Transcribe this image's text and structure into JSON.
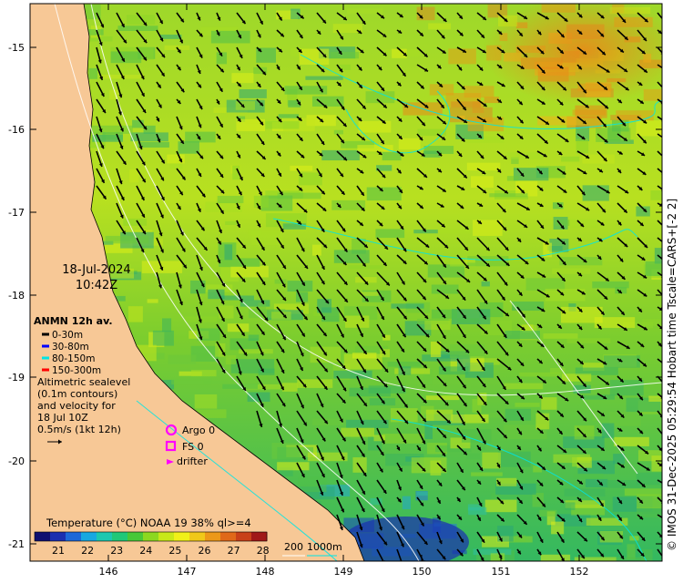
{
  "map": {
    "lon_ticks": [
      "146",
      "147",
      "148",
      "149",
      "150",
      "151",
      "152"
    ],
    "lat_ticks": [
      "15",
      "16",
      "17",
      "18",
      "19",
      "20",
      "21"
    ],
    "lat_prefix": "-"
  },
  "overlay": {
    "date": "18-Jul-2024",
    "time": "10:42Z",
    "anmn_title": "ANMN 12h av.",
    "anmn_items": [
      {
        "label": "0-30m",
        "color": "#000000"
      },
      {
        "label": "30-80m",
        "color": "#0000ff"
      },
      {
        "label": "80-150m",
        "color": "#00e5e5"
      },
      {
        "label": "150-300m",
        "color": "#ff0000"
      }
    ],
    "altimetry_lines": [
      "Altimetric sealevel",
      "(0.1m contours)",
      "and velocity for",
      "18 Jul 10Z",
      "0.5m/s (1kt 12h)"
    ],
    "argo_label": "Argo 0",
    "fs_label": "FS 0",
    "drifter_label": "drifter",
    "marker_color": "#ff00ff"
  },
  "colorbar": {
    "title": "Temperature (°C) NOAA 19 38% ql>=4",
    "ticks": [
      "21",
      "22",
      "23",
      "24",
      "25",
      "26",
      "27",
      "28"
    ],
    "colors": [
      "#101070",
      "#1a2fb0",
      "#1c68d8",
      "#18a8e0",
      "#1cc8b0",
      "#20c878",
      "#48c838",
      "#8cd820",
      "#c8e818",
      "#f0f018",
      "#f0c818",
      "#ec9818",
      "#e06818",
      "#c84018",
      "#a01818"
    ]
  },
  "bathymetry": {
    "label_200": "200",
    "label_1000": "1000m"
  },
  "credit": "© IMOS 31-Dec-2025 05:29:54 Hobart time Tscale=CARS+[-2 2]"
}
